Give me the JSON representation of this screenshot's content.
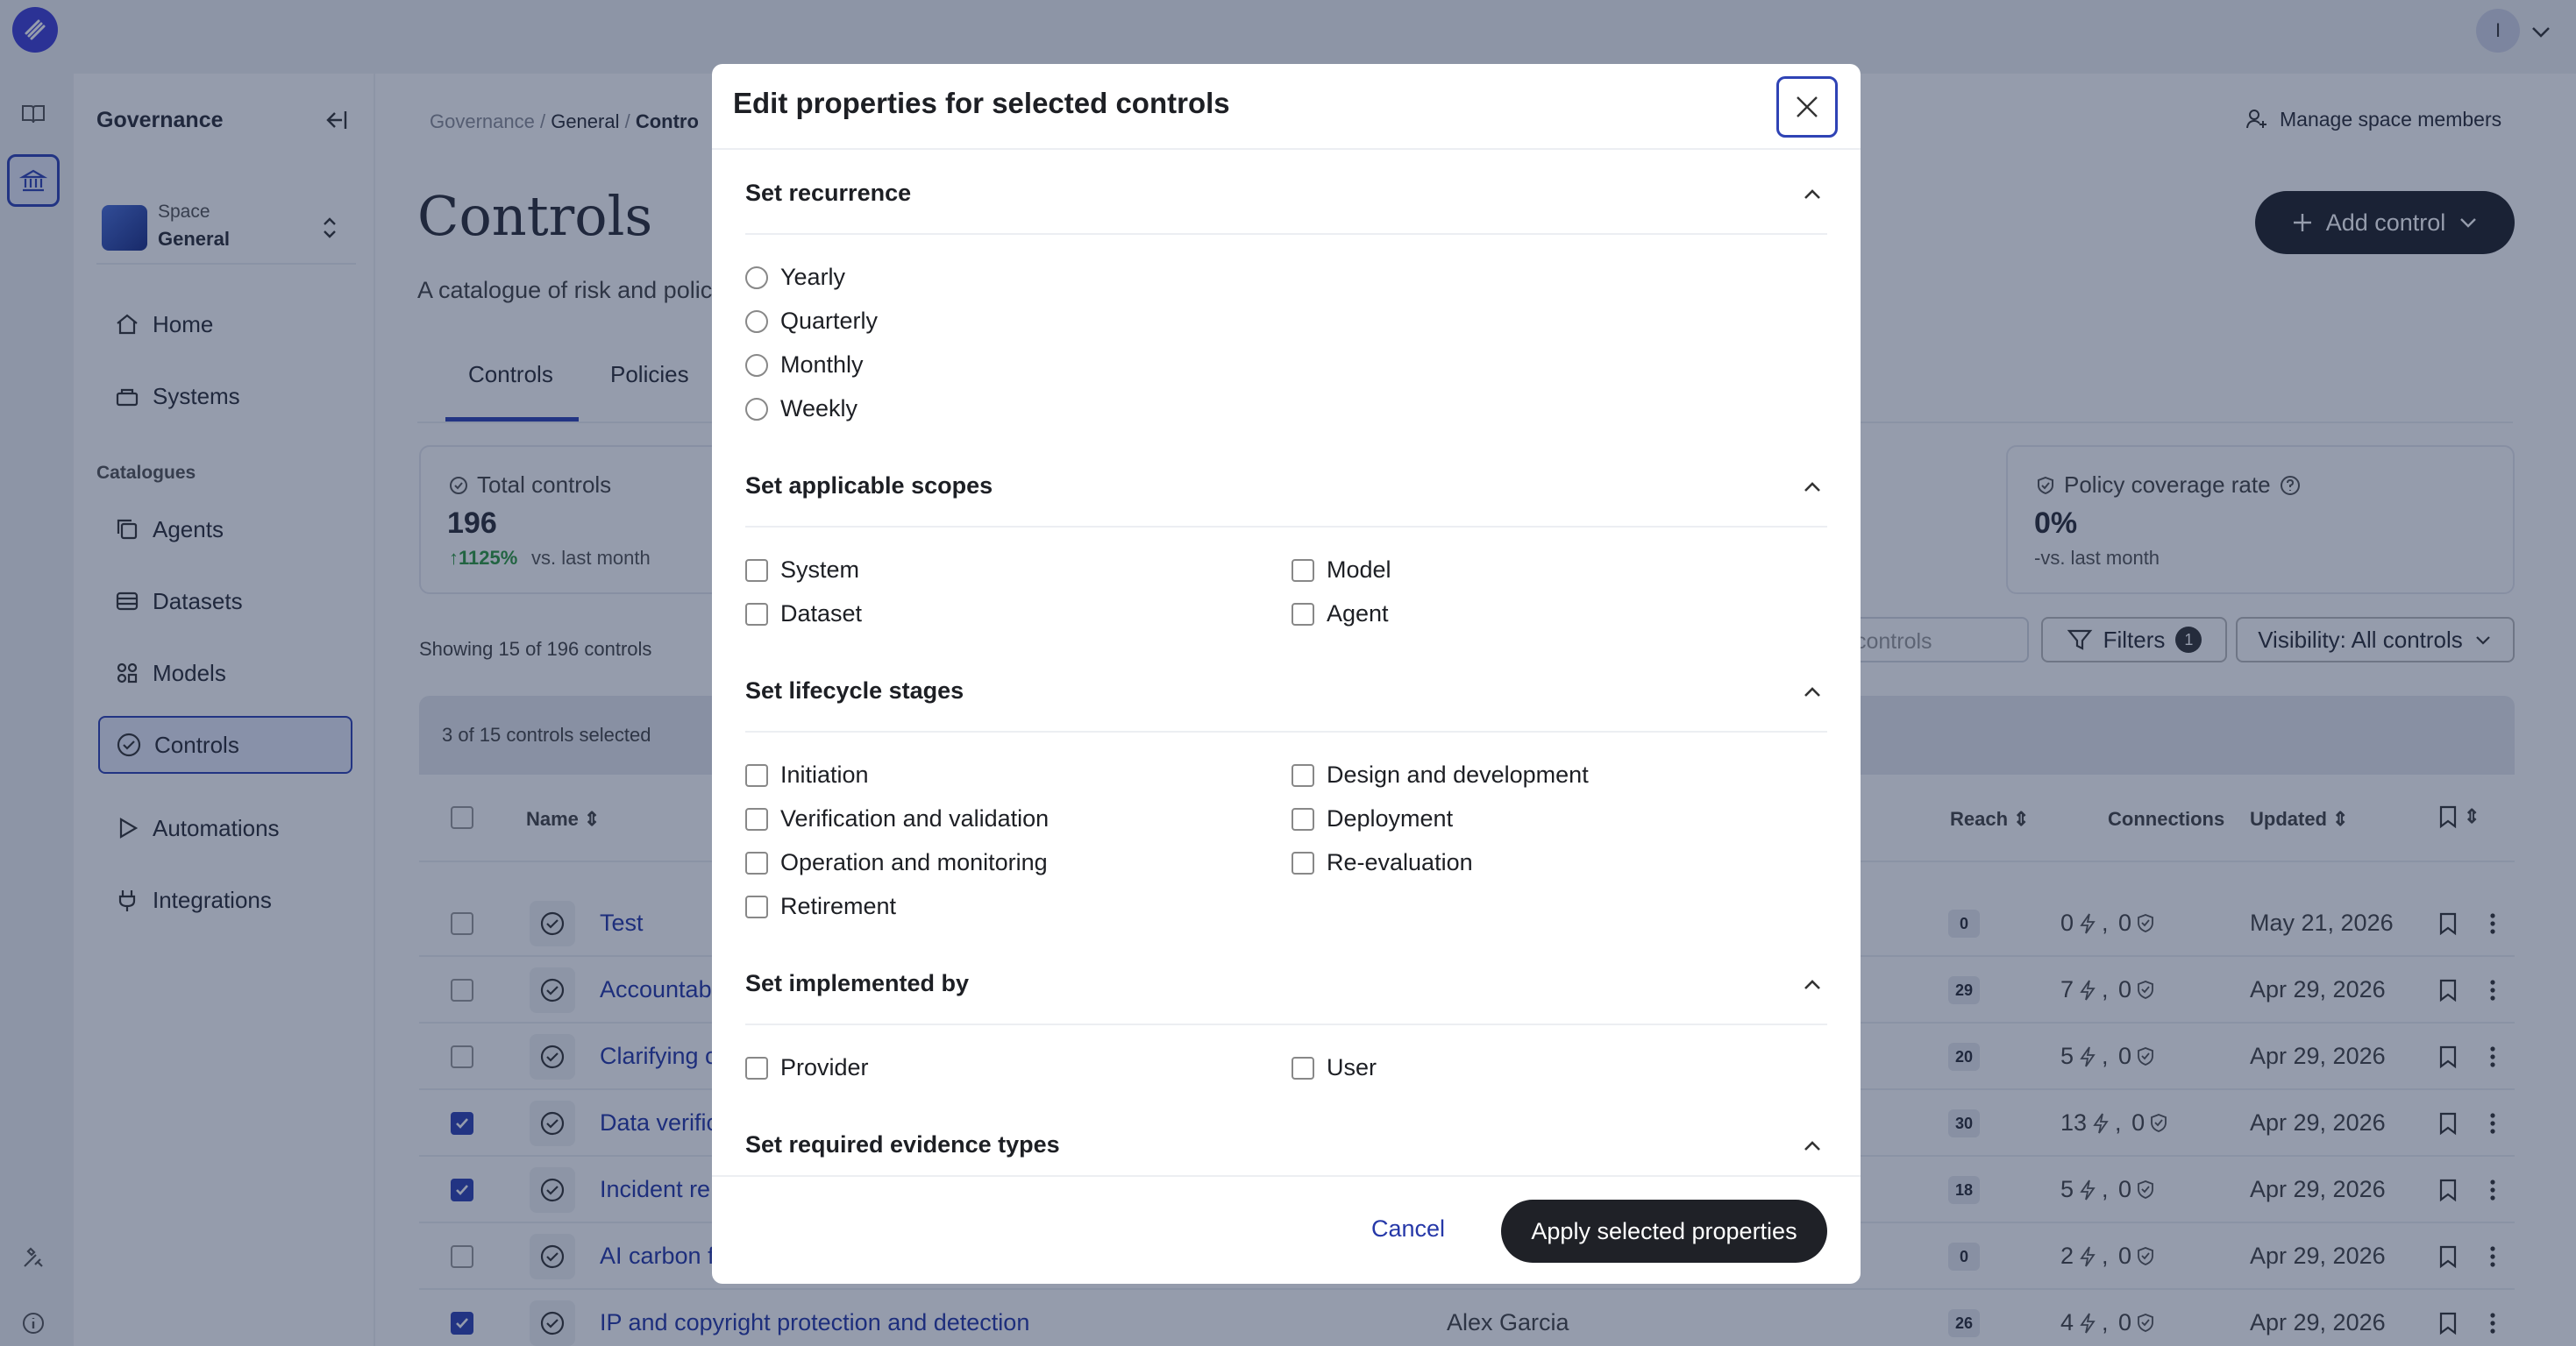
{
  "topbar": {
    "avatar_initial": "I"
  },
  "sidebar": {
    "title": "Governance",
    "space_label": "Space",
    "space_name": "General",
    "nav": [
      "Home",
      "Systems"
    ],
    "catalogues_heading": "Catalogues",
    "catalogues": [
      "Agents",
      "Datasets",
      "Models",
      "Controls"
    ],
    "extra": [
      "Automations",
      "Integrations"
    ]
  },
  "header": {
    "breadcrumb": [
      "Governance",
      "General",
      "Contro"
    ],
    "manage_label": "Manage space members",
    "page_title": "Controls",
    "add_label": "Add control",
    "subtitle": "A catalogue of risk and polic"
  },
  "tabs": [
    "Controls",
    "Policies"
  ],
  "cards": {
    "total": {
      "label": "Total controls",
      "value": "196",
      "delta": "1125%",
      "vs": "vs. last month"
    },
    "coverage": {
      "label": "Policy coverage rate",
      "value": "0%",
      "vs": "-vs. last month"
    }
  },
  "toolbar": {
    "showing": "Showing 15 of 196 controls",
    "search_placeholder": "controls",
    "filters_label": "Filters",
    "filters_count": "1",
    "visibility_label": "Visibility: All controls"
  },
  "table": {
    "selected_text": "3 of 15 controls selected",
    "columns": {
      "name": "Name",
      "reach": "Reach",
      "connections": "Connections",
      "updated": "Updated"
    },
    "rows": [
      {
        "name": "Test",
        "owner": "",
        "reach": "0",
        "c1": "0",
        "c2": "0",
        "updated": "May 21, 2026",
        "checked": false
      },
      {
        "name": "Accountab",
        "owner": "",
        "reach": "29",
        "c1": "7",
        "c2": "0",
        "updated": "Apr 29, 2026",
        "checked": false
      },
      {
        "name": "Clarifying c",
        "owner": "",
        "reach": "20",
        "c1": "5",
        "c2": "0",
        "updated": "Apr 29, 2026",
        "checked": false
      },
      {
        "name": "Data verific",
        "owner": "",
        "reach": "30",
        "c1": "13",
        "c2": "0",
        "updated": "Apr 29, 2026",
        "checked": true
      },
      {
        "name": "Incident re",
        "owner": "",
        "reach": "18",
        "c1": "5",
        "c2": "0",
        "updated": "Apr 29, 2026",
        "checked": true
      },
      {
        "name": "AI carbon f",
        "owner": "",
        "reach": "0",
        "c1": "2",
        "c2": "0",
        "updated": "Apr 29, 2026",
        "checked": false
      },
      {
        "name": "IP and copyright protection and detection",
        "owner": "Alex Garcia",
        "reach": "26",
        "c1": "4",
        "c2": "0",
        "updated": "Apr 29, 2026",
        "checked": true
      }
    ]
  },
  "modal": {
    "title": "Edit properties for selected controls",
    "sections": {
      "recurrence": {
        "title": "Set recurrence",
        "options": [
          "Yearly",
          "Quarterly",
          "Monthly",
          "Weekly"
        ]
      },
      "scopes": {
        "title": "Set applicable scopes",
        "options": [
          "System",
          "Model",
          "Dataset",
          "Agent"
        ]
      },
      "lifecycle": {
        "title": "Set lifecycle stages",
        "options": [
          "Initiation",
          "Design and development",
          "Verification and validation",
          "Deployment",
          "Operation and monitoring",
          "Re-evaluation",
          "Retirement"
        ]
      },
      "implemented": {
        "title": "Set implemented by",
        "options": [
          "Provider",
          "User"
        ]
      },
      "evidence": {
        "title": "Set required evidence types"
      }
    },
    "cancel_label": "Cancel",
    "apply_label": "Apply selected properties"
  },
  "colors": {
    "accent": "#2f43b5",
    "dark_button": "#1f2127",
    "link": "#2638a8"
  }
}
